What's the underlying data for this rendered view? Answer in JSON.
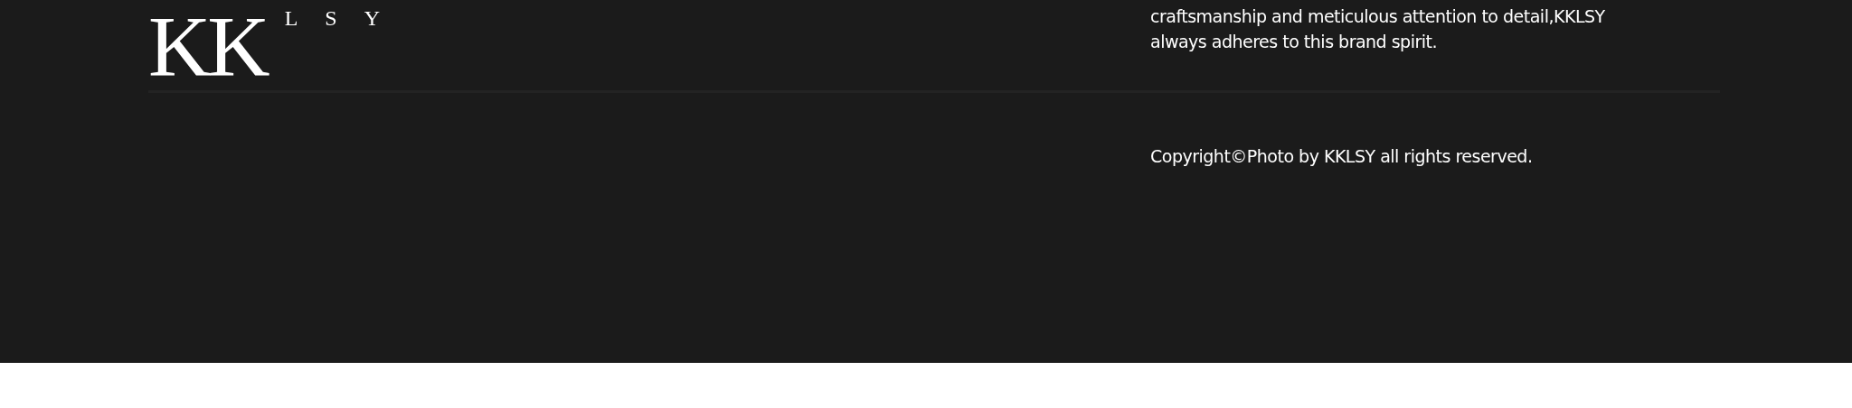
{
  "footer": {
    "logo": {
      "large": "KK",
      "small": "LSY"
    },
    "description_lines": [
      "craftsmanship and meticulous attention to detail,KKLSY",
      "always adheres to this brand spirit."
    ],
    "copyright": "Copyright©Photo by KKLSY all rights reserved."
  }
}
